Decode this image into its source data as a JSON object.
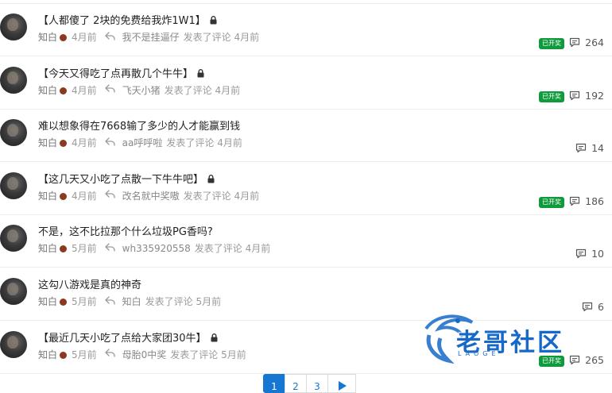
{
  "topics": [
    {
      "title": "【人都傻了 2块的免费给我炸1W1】",
      "locked": true,
      "author": "知白",
      "time": "4月前",
      "replier": "我不是挂逼仔",
      "reply_action": "发表了评论",
      "reply_time": "4月前",
      "badge": "已开奖",
      "comments": "264"
    },
    {
      "title": "【今天又得吃了点再散几个牛牛】",
      "locked": true,
      "author": "知白",
      "time": "4月前",
      "replier": "飞天小猪",
      "reply_action": "发表了评论",
      "reply_time": "4月前",
      "badge": "已开奖",
      "comments": "192"
    },
    {
      "title": "难以想象得在7668输了多少的人才能赢到钱",
      "locked": false,
      "author": "知白",
      "time": "4月前",
      "replier": "aa呼呼啦",
      "reply_action": "发表了评论",
      "reply_time": "4月前",
      "badge": "",
      "comments": "14"
    },
    {
      "title": "【这几天又小吃了点散一下牛牛吧】",
      "locked": true,
      "author": "知白",
      "time": "4月前",
      "replier": "改名就中奖嗷",
      "reply_action": "发表了评论",
      "reply_time": "4月前",
      "badge": "已开奖",
      "comments": "186"
    },
    {
      "title": "不是，这不比拉那个什么垃圾PG香吗?",
      "locked": false,
      "author": "知白",
      "time": "5月前",
      "replier": "wh335920558",
      "reply_action": "发表了评论",
      "reply_time": "4月前",
      "badge": "",
      "comments": "10"
    },
    {
      "title": "这勾八游戏是真的神奇",
      "locked": false,
      "author": "知白",
      "time": "5月前",
      "replier": "知白",
      "reply_action": "发表了评论",
      "reply_time": "5月前",
      "badge": "",
      "comments": "6"
    },
    {
      "title": "【最近几天小吃了点给大家团30牛】",
      "locked": true,
      "author": "知白",
      "time": "5月前",
      "replier": "母胎0中奖",
      "reply_action": "发表了评论",
      "reply_time": "5月前",
      "badge": "已开奖",
      "comments": "265"
    }
  ],
  "pagination": {
    "pages": [
      "1",
      "2",
      "3"
    ],
    "current": "1",
    "next_icon": "play-next-icon"
  },
  "watermark": {
    "text": "老哥社区",
    "sub": "LAOGE"
  },
  "colors": {
    "accent": "#1677d2",
    "badge": "#0f9a3c"
  }
}
